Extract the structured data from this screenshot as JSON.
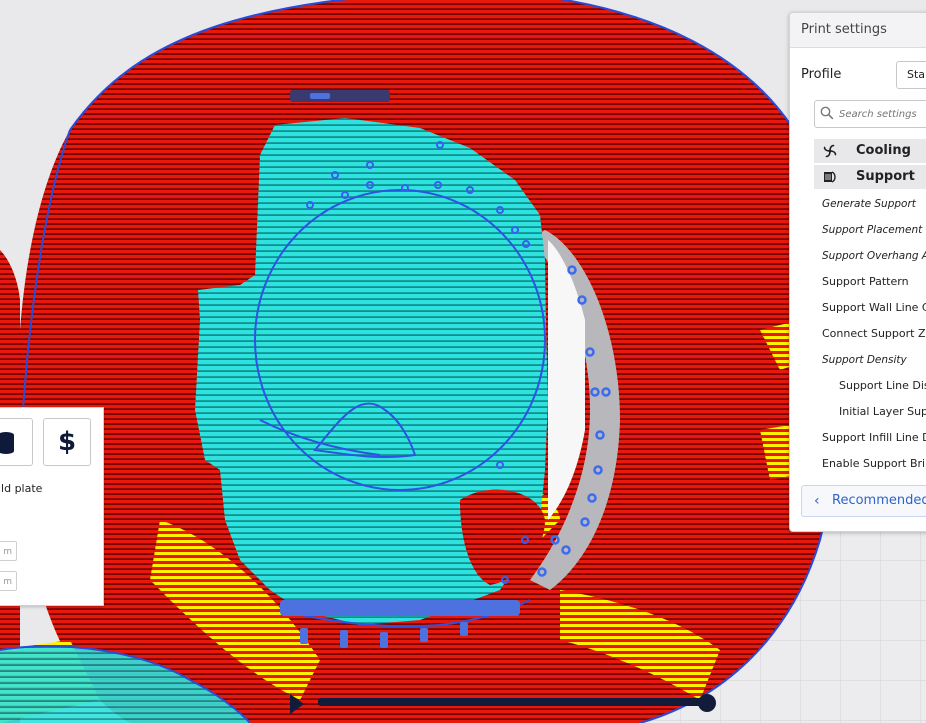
{
  "panel": {
    "title": "Print settings",
    "profile_label": "Profile",
    "profile_value": "Star",
    "search_placeholder": "Search settings",
    "categories": [
      {
        "label": "Cooling",
        "icon": "fan-icon"
      },
      {
        "label": "Support",
        "icon": "support-icon"
      }
    ],
    "settings": [
      {
        "label": "Generate Support",
        "italic": true,
        "indent": false
      },
      {
        "label": "Support Placement",
        "italic": true,
        "indent": false
      },
      {
        "label": "Support Overhang Ang",
        "italic": true,
        "indent": false
      },
      {
        "label": "Support Pattern",
        "italic": false,
        "indent": false
      },
      {
        "label": "Support Wall Line Co",
        "italic": false,
        "indent": false
      },
      {
        "label": "Connect Support Zig",
        "italic": false,
        "indent": false
      },
      {
        "label": "Support Density",
        "italic": true,
        "indent": false
      },
      {
        "label": "Support Line Dis",
        "italic": false,
        "indent": true
      },
      {
        "label": "Initial Layer Supp",
        "italic": false,
        "indent": true
      },
      {
        "label": "Support Infill Line D",
        "italic": false,
        "indent": false
      },
      {
        "label": "Enable Support Brim",
        "italic": false,
        "indent": false
      }
    ],
    "recommended_label": "Recommended"
  },
  "tool_panel": {
    "text_1": "uild plate",
    "text_2": "e",
    "field_1": "m",
    "field_2": "m",
    "dollar": "$"
  },
  "colors": {
    "wall_red": "#ee1c0e",
    "infill_yellow": "#fff200",
    "support_cyan": "#25e0dc",
    "support_blue": "#4d72e0",
    "accent_blue": "#2f63c9"
  }
}
